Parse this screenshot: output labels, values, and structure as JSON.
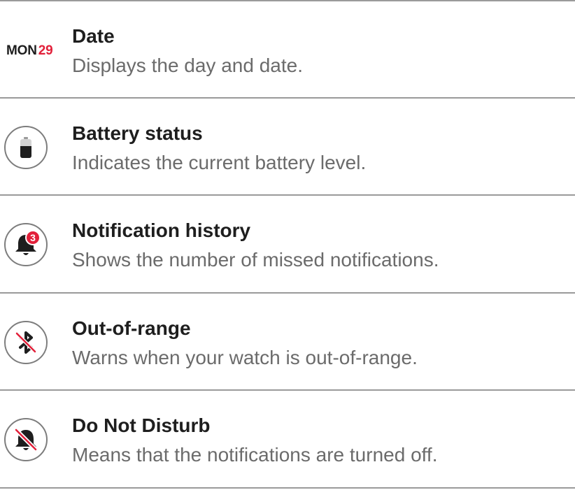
{
  "accent_color": "#e2203a",
  "rows": [
    {
      "icon": "calendar-date-icon",
      "icon_day": "MON",
      "icon_date": "29",
      "title": "Date",
      "description": "Displays the day and date."
    },
    {
      "icon": "battery-icon",
      "title": "Battery status",
      "description": "Indicates the current battery level."
    },
    {
      "icon": "bell-badge-icon",
      "badge_count": "3",
      "title": "Notification history",
      "description": "Shows the number of missed notifications."
    },
    {
      "icon": "bluetooth-off-icon",
      "title": "Out-of-range",
      "description": "Warns when your watch is out-of-range."
    },
    {
      "icon": "bell-off-icon",
      "title": "Do Not Disturb",
      "description": "Means that the notifications are turned off."
    }
  ]
}
